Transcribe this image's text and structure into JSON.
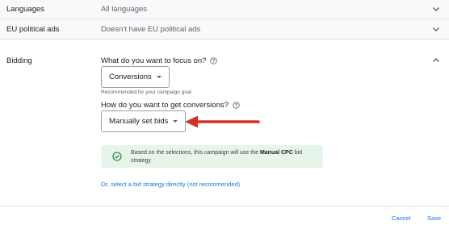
{
  "rows": {
    "languages": {
      "label": "Languages",
      "value": "All languages"
    },
    "eu_political_ads": {
      "label": "EU political ads",
      "value": "Doesn't have EU political ads"
    }
  },
  "bidding": {
    "label": "Bidding",
    "focus_question": "What do you want to focus on?",
    "focus_selected": "Conversions",
    "focus_hint": "Recommended for your campaign goal",
    "conversions_question": "How do you want to get conversions?",
    "conversions_selected": "Manually set bids",
    "info": {
      "text_before": "Based on the selections, this campaign will use the ",
      "strategy": "Manual CPC",
      "text_after": " bid strategy"
    },
    "direct_link": "Or, select a bid strategy directly (not recommended)"
  },
  "footer": {
    "cancel_label": "Cancel",
    "save_label": "Save"
  },
  "colors": {
    "accent_blue": "#1a73e8",
    "success_green": "#188038",
    "success_bg": "#e6f4ea",
    "annotation_red": "#d93025"
  },
  "icons": {
    "collapsed_row": "chevron-down-icon",
    "expanded_section": "chevron-up-icon",
    "help": "help-circle-icon",
    "info_status": "check-circle-icon",
    "annotation": "red-arrow-icon"
  }
}
